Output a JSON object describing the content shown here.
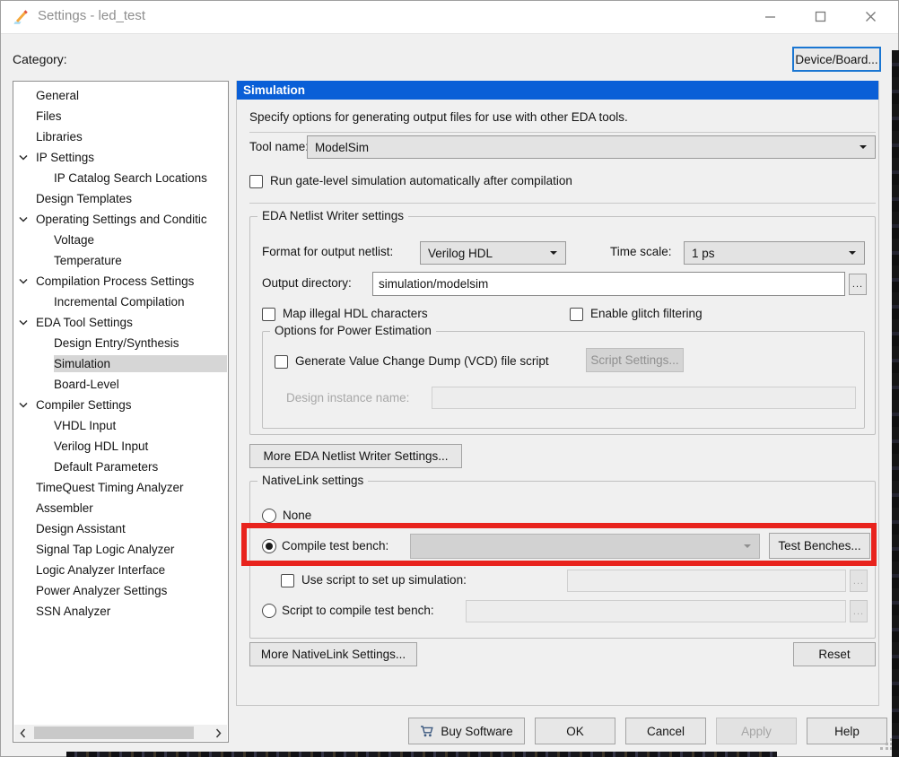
{
  "window": {
    "title": "Settings - led_test",
    "icon": "pencil-icon",
    "controls": [
      "minimize",
      "maximize",
      "close"
    ]
  },
  "header": {
    "category_label": "Category:",
    "device_board_button": "Device/Board..."
  },
  "sidebar": {
    "items": [
      {
        "label": "General",
        "level": 0,
        "chevron": false,
        "selected": false
      },
      {
        "label": "Files",
        "level": 0,
        "chevron": false,
        "selected": false
      },
      {
        "label": "Libraries",
        "level": 0,
        "chevron": false,
        "selected": false
      },
      {
        "label": "IP Settings",
        "level": 0,
        "chevron": true,
        "selected": false
      },
      {
        "label": "IP Catalog Search Locations",
        "level": 1,
        "chevron": false,
        "selected": false
      },
      {
        "label": "Design Templates",
        "level": 0,
        "chevron": false,
        "selected": false
      },
      {
        "label": "Operating Settings and Conditic",
        "level": 0,
        "chevron": true,
        "selected": false
      },
      {
        "label": "Voltage",
        "level": 1,
        "chevron": false,
        "selected": false
      },
      {
        "label": "Temperature",
        "level": 1,
        "chevron": false,
        "selected": false
      },
      {
        "label": "Compilation Process Settings",
        "level": 0,
        "chevron": true,
        "selected": false
      },
      {
        "label": "Incremental Compilation",
        "level": 1,
        "chevron": false,
        "selected": false
      },
      {
        "label": "EDA Tool Settings",
        "level": 0,
        "chevron": true,
        "selected": false
      },
      {
        "label": "Design Entry/Synthesis",
        "level": 1,
        "chevron": false,
        "selected": false
      },
      {
        "label": "Simulation",
        "level": 1,
        "chevron": false,
        "selected": true
      },
      {
        "label": "Board-Level",
        "level": 1,
        "chevron": false,
        "selected": false
      },
      {
        "label": "Compiler Settings",
        "level": 0,
        "chevron": true,
        "selected": false
      },
      {
        "label": "VHDL Input",
        "level": 1,
        "chevron": false,
        "selected": false
      },
      {
        "label": "Verilog HDL Input",
        "level": 1,
        "chevron": false,
        "selected": false
      },
      {
        "label": "Default Parameters",
        "level": 1,
        "chevron": false,
        "selected": false
      },
      {
        "label": "TimeQuest Timing Analyzer",
        "level": 0,
        "chevron": false,
        "selected": false
      },
      {
        "label": "Assembler",
        "level": 0,
        "chevron": false,
        "selected": false
      },
      {
        "label": "Design Assistant",
        "level": 0,
        "chevron": false,
        "selected": false
      },
      {
        "label": "Signal Tap Logic Analyzer",
        "level": 0,
        "chevron": false,
        "selected": false
      },
      {
        "label": "Logic Analyzer Interface",
        "level": 0,
        "chevron": false,
        "selected": false
      },
      {
        "label": "Power Analyzer Settings",
        "level": 0,
        "chevron": false,
        "selected": false
      },
      {
        "label": "SSN Analyzer",
        "level": 0,
        "chevron": false,
        "selected": false
      }
    ]
  },
  "main": {
    "panel_title": "Simulation",
    "description": "Specify options for generating output files for use with other EDA tools.",
    "tool_name": {
      "label": "Tool name:",
      "value": "ModelSim"
    },
    "run_gate_level": {
      "label": "Run gate-level simulation automatically after compilation",
      "checked": false
    },
    "eda_netlist_group": {
      "title": "EDA Netlist Writer settings",
      "format_label": "Format for output netlist:",
      "format_value": "Verilog HDL",
      "time_scale_label": "Time scale:",
      "time_scale_value": "1 ps",
      "output_dir_label": "Output directory:",
      "output_dir_value": "simulation/modelsim",
      "browse_label": "...",
      "map_illegal_label": "Map illegal HDL characters",
      "glitch_label": "Enable glitch filtering",
      "power_group": {
        "title": "Options for Power Estimation",
        "vcd_label": "Generate Value Change Dump (VCD) file script",
        "script_settings_button": "Script Settings...",
        "design_instance_label": "Design instance name:",
        "design_instance_value": ""
      }
    },
    "more_eda_button": "More EDA Netlist Writer Settings...",
    "nativelink_group": {
      "title": "NativeLink settings",
      "none_label": "None",
      "compile_tb_label": "Compile test bench:",
      "compile_tb_value": "",
      "test_benches_button": "Test Benches...",
      "use_script_label": "Use script to set up simulation:",
      "use_script_value": "",
      "script_compile_label": "Script to compile test bench:",
      "script_compile_value": "",
      "browse_label": "..."
    },
    "more_nativelink_button": "More NativeLink Settings...",
    "reset_button": "Reset"
  },
  "footer": {
    "buttons": [
      {
        "label": "Buy Software",
        "icon": "cart-icon",
        "disabled": false
      },
      {
        "label": "OK",
        "disabled": false
      },
      {
        "label": "Cancel",
        "disabled": false
      },
      {
        "label": "Apply",
        "disabled": true
      },
      {
        "label": "Help",
        "disabled": false
      }
    ]
  },
  "colors": {
    "panel_header_blue": "#0a5fd7",
    "highlight_red": "#e8231d",
    "selection_gray": "#d6d6d6",
    "focus_blue": "#1a76d2"
  }
}
